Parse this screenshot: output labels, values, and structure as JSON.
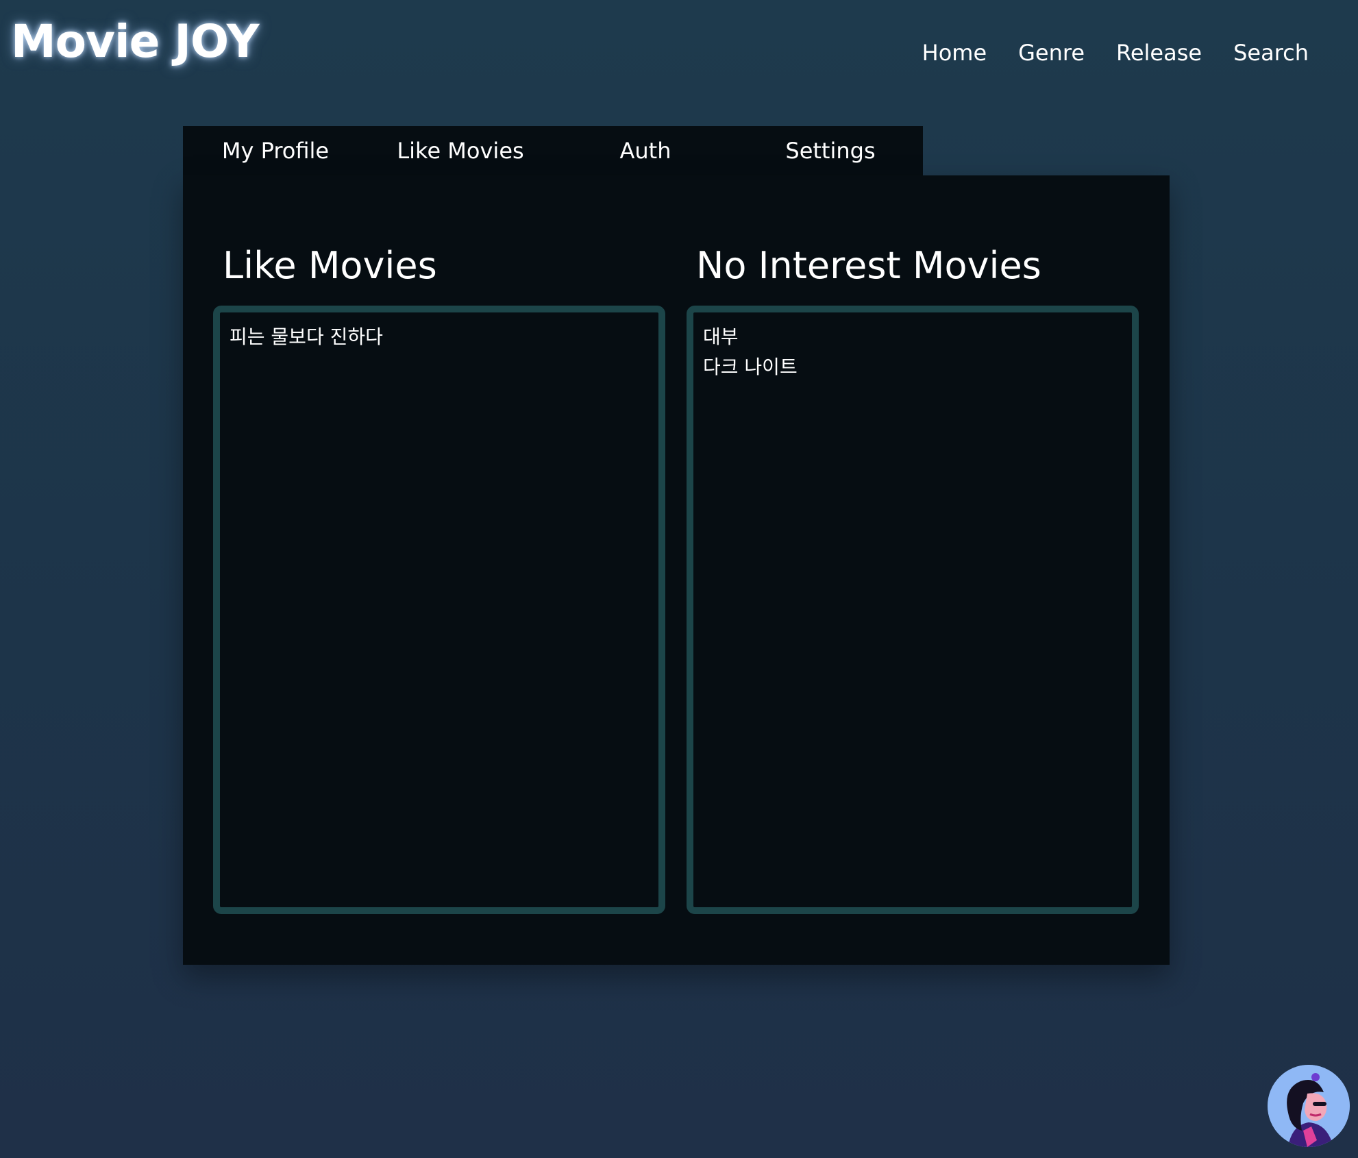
{
  "header": {
    "logo": "Movie JOY",
    "nav": [
      "Home",
      "Genre",
      "Release",
      "Search"
    ]
  },
  "tabs": [
    "My Profile",
    "Like Movies",
    "Auth",
    "Settings"
  ],
  "like_section": {
    "title": "Like Movies",
    "items": [
      "피는 물보다 진하다"
    ]
  },
  "no_interest_section": {
    "title": "No Interest Movies",
    "items": [
      "대부",
      "다크 나이트"
    ]
  },
  "colors": {
    "background": "#1e3a4d",
    "panel": "#060d12",
    "list_border": "#1c4549",
    "avatar_bg": "#8fb8f5",
    "avatar_accent": "#e0409a"
  },
  "icons": {
    "avatar": "user-avatar-icon"
  }
}
